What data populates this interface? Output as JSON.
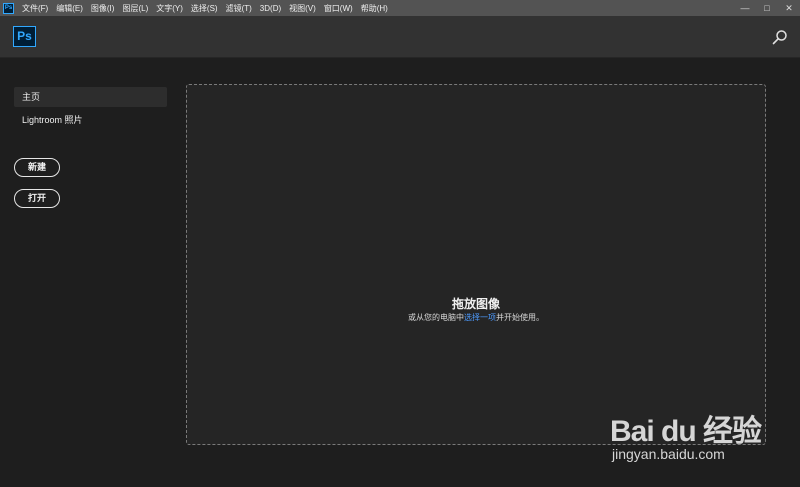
{
  "app": {
    "icon_label": "Ps",
    "accent_color": "#31a8ff"
  },
  "menubar": {
    "items": [
      "文件(F)",
      "编辑(E)",
      "图像(I)",
      "图层(L)",
      "文字(Y)",
      "选择(S)",
      "滤镜(T)",
      "3D(D)",
      "视图(V)",
      "窗口(W)",
      "帮助(H)"
    ],
    "window_controls": {
      "minimize": "—",
      "maximize": "□",
      "close": "✕"
    }
  },
  "header": {
    "logo": "Ps",
    "search_icon": "search-icon"
  },
  "sidebar": {
    "items": [
      {
        "label": "主页",
        "selected": true
      },
      {
        "label": "Lightroom 照片",
        "selected": false
      }
    ],
    "new_label": "新建",
    "open_label": "打开"
  },
  "dropzone": {
    "title": "拖放图像",
    "subtitle_before": "或从您的电脑中",
    "subtitle_link": "选择一项",
    "subtitle_after": "并开始使用。",
    "link_color": "#4d9bff"
  },
  "watermark": {
    "brand": "Bai du 经验",
    "url": "jingyan.baidu.com"
  }
}
